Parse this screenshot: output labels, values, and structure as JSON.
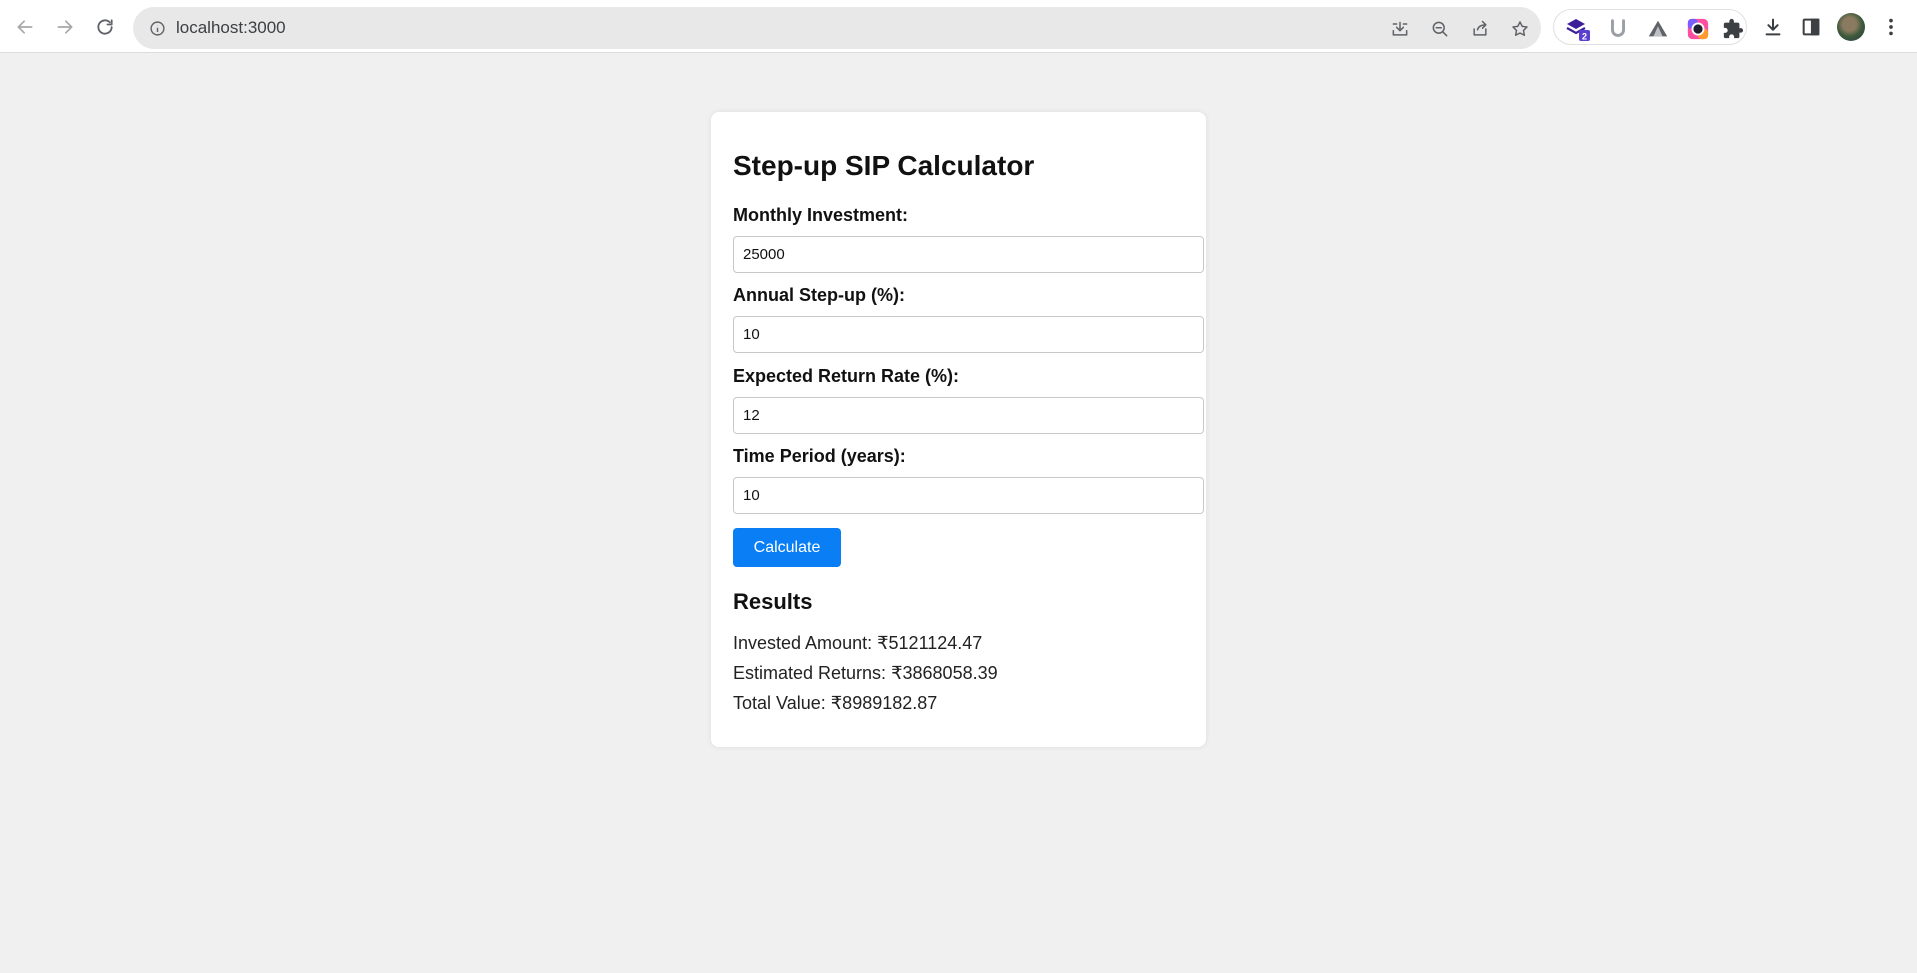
{
  "browser": {
    "url": "localhost:3000",
    "extension_badge_count": "2"
  },
  "form": {
    "title": "Step-up SIP Calculator",
    "fields": [
      {
        "label": "Monthly Investment:",
        "value": "25000"
      },
      {
        "label": "Annual Step-up (%):",
        "value": "10"
      },
      {
        "label": "Expected Return Rate (%):",
        "value": "12"
      },
      {
        "label": "Time Period (years):",
        "value": "10"
      }
    ],
    "button_label": "Calculate",
    "button_color": "#0a7ff5"
  },
  "results": {
    "title": "Results",
    "lines": [
      "Invested Amount: ₹5121124.47",
      "Estimated Returns: ₹3868058.39",
      "Total Value: ₹8989182.87"
    ]
  }
}
